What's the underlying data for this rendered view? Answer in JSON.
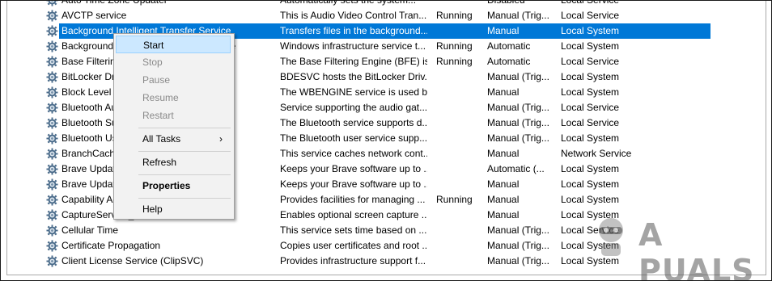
{
  "services": [
    {
      "name": "Auto Time Zone Updater",
      "description": "Automatically sets the system...",
      "status": "",
      "startup": "Disabled",
      "logon": "Local Service"
    },
    {
      "name": "AVCTP service",
      "description": "This is Audio Video Control Tran...",
      "status": "Running",
      "startup": "Manual (Trig...",
      "logon": "Local Service"
    },
    {
      "name": "Background Intelligent Transfer Service",
      "description": "Transfers files in the background...",
      "status": "",
      "startup": "Manual",
      "logon": "Local System"
    },
    {
      "name": "Background Tasks Infrastructure Service",
      "description": "Windows infrastructure service t...",
      "status": "Running",
      "startup": "Automatic",
      "logon": "Local System"
    },
    {
      "name": "Base Filtering Engine",
      "description": "The Base Filtering Engine (BFE) is...",
      "status": "Running",
      "startup": "Automatic",
      "logon": "Local Service"
    },
    {
      "name": "BitLocker Drive Encryption Service",
      "description": "BDESVC hosts the BitLocker Driv...",
      "status": "",
      "startup": "Manual (Trig...",
      "logon": "Local System"
    },
    {
      "name": "Block Level Backup Engine Service",
      "description": "The WBENGINE service is used b...",
      "status": "",
      "startup": "Manual",
      "logon": "Local System"
    },
    {
      "name": "Bluetooth Audio Gateway Service",
      "description": "Service supporting the audio gat...",
      "status": "",
      "startup": "Manual (Trig...",
      "logon": "Local Service"
    },
    {
      "name": "Bluetooth Support Service",
      "description": "The Bluetooth service supports d...",
      "status": "",
      "startup": "Manual (Trig...",
      "logon": "Local Service"
    },
    {
      "name": "Bluetooth User Support Service",
      "description": "The Bluetooth user service supp...",
      "status": "",
      "startup": "Manual (Trig...",
      "logon": "Local System"
    },
    {
      "name": "BranchCache",
      "description": "This service caches network cont...",
      "status": "",
      "startup": "Manual",
      "logon": "Network Service"
    },
    {
      "name": "Brave Update Service (brave)",
      "description": "Keeps your Brave software up to ...",
      "status": "",
      "startup": "Automatic (...",
      "logon": "Local System"
    },
    {
      "name": "Brave Update Service (bravem)",
      "description": "Keeps your Brave software up to ...",
      "status": "",
      "startup": "Manual",
      "logon": "Local System"
    },
    {
      "name": "Capability Access Manager Service",
      "description": "Provides facilities for managing ...",
      "status": "Running",
      "startup": "Manual",
      "logon": "Local System"
    },
    {
      "name": "CaptureService_fcc71",
      "description": "Enables optional screen capture ...",
      "status": "",
      "startup": "Manual",
      "logon": "Local System"
    },
    {
      "name": "Cellular Time",
      "description": "This service sets time based on ...",
      "status": "",
      "startup": "Manual (Trig...",
      "logon": "Local Service"
    },
    {
      "name": "Certificate Propagation",
      "description": "Copies user certificates and root ...",
      "status": "",
      "startup": "Manual (Trig...",
      "logon": "Local System"
    },
    {
      "name": "Client License Service (ClipSVC)",
      "description": "Provides infrastructure support f...",
      "status": "",
      "startup": "Manual (Trig...",
      "logon": "Local System"
    }
  ],
  "selected_index": 2,
  "context_menu": {
    "items": [
      {
        "label": "Start",
        "state": "hover"
      },
      {
        "label": "Stop",
        "state": "disabled"
      },
      {
        "label": "Pause",
        "state": "disabled"
      },
      {
        "label": "Resume",
        "state": "disabled"
      },
      {
        "label": "Restart",
        "state": "disabled"
      },
      {
        "label": "All Tasks",
        "state": "submenu"
      },
      {
        "label": "Refresh",
        "state": "normal"
      },
      {
        "label": "Properties",
        "state": "bold"
      },
      {
        "label": "Help",
        "state": "normal"
      }
    ],
    "submenu_arrow": "›"
  },
  "watermark": {
    "text": "A PUALS"
  },
  "colors": {
    "selection": "#0078d7",
    "menu_hover": "#cce8ff",
    "disabled_text": "#8a8a8a"
  },
  "icons": {
    "service": "gear-icon"
  }
}
